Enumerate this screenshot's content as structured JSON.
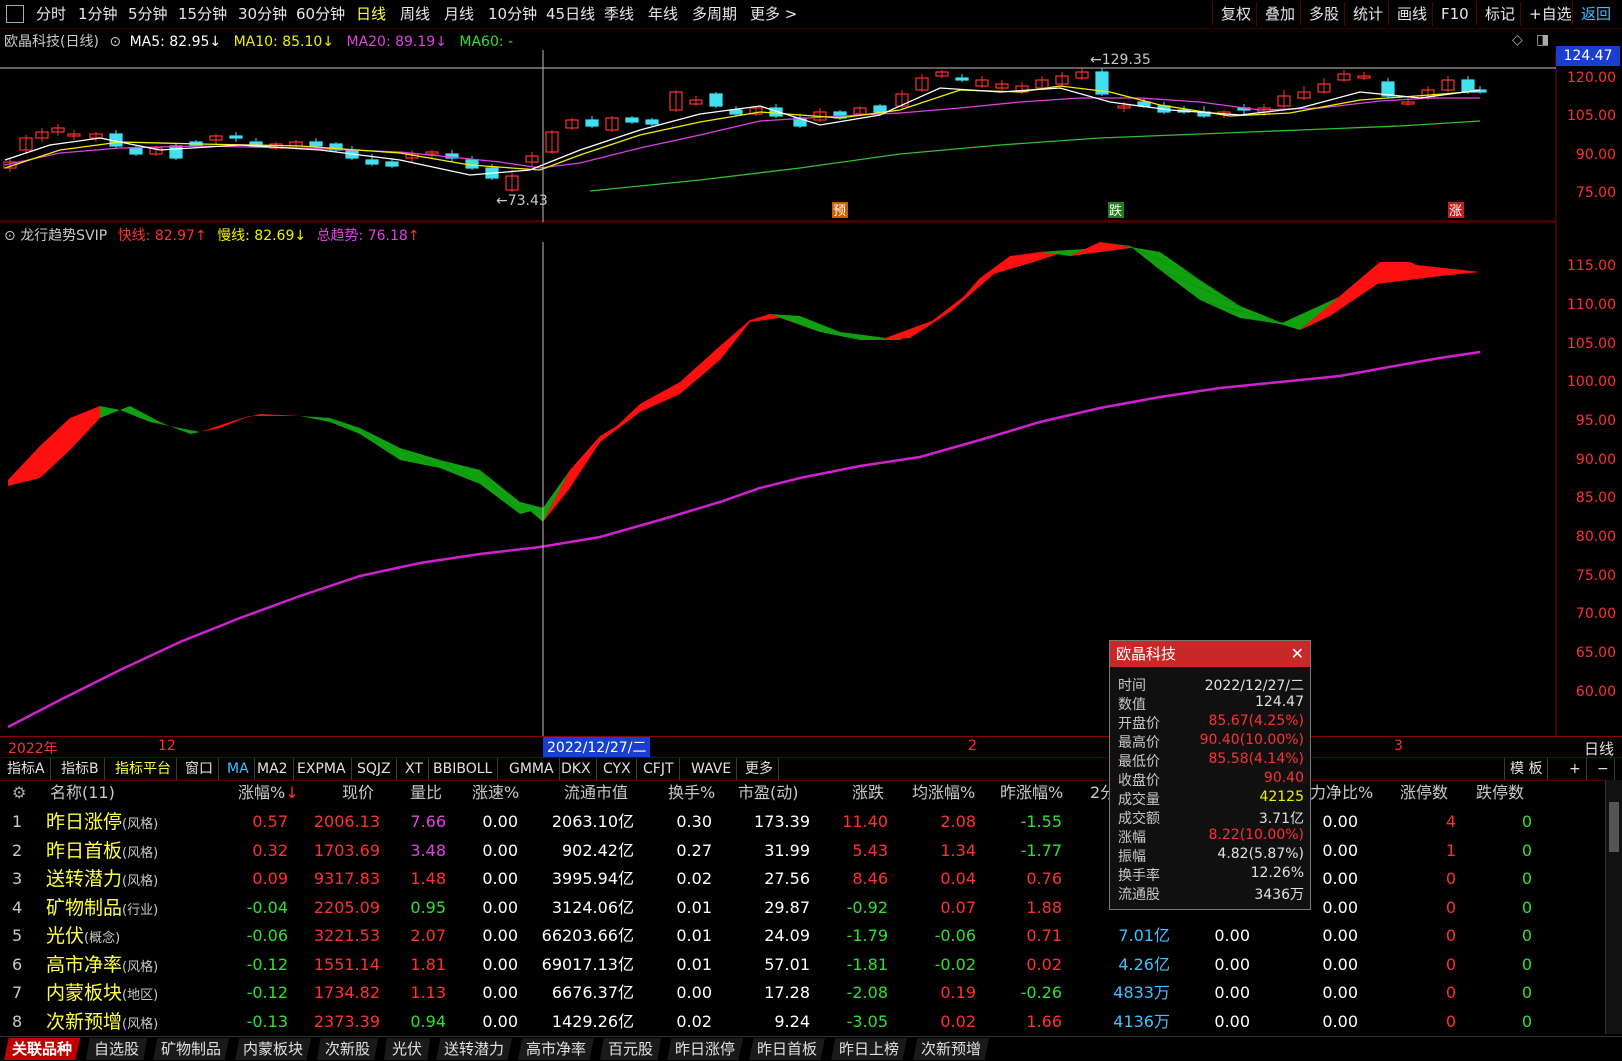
{
  "toolbar": {
    "periods": [
      "分时",
      "1分钟",
      "5分钟",
      "15分钟",
      "30分钟",
      "60分钟",
      "日线",
      "周线",
      "月线",
      "10分钟",
      "45日线",
      "季线",
      "年线",
      "多周期",
      "更多 >"
    ],
    "active_period": "日线",
    "right_buttons": [
      "复权",
      "叠加",
      "多股",
      "统计",
      "画线",
      "F10",
      "标记",
      "+自选",
      "返回"
    ]
  },
  "main_chart": {
    "title": "欧晶科技(日线)",
    "ma5": "MA5: 82.95",
    "ma10": "MA10: 85.10",
    "ma20": "MA20: 89.19",
    "ma60": "MA60: -",
    "high_mark": "129.35",
    "low_mark": "73.43",
    "current_price_tag": "124.47",
    "y_ticks": [
      "120.00",
      "105.00",
      "90.00",
      "75.00"
    ],
    "signals": [
      "预",
      "跌",
      "涨"
    ],
    "colors": {
      "ma5": "#ffffff",
      "ma10": "#f0f000",
      "ma20": "#e040e0",
      "ma60": "#30c030",
      "up": "#ff3030",
      "down": "#40e0f0"
    }
  },
  "indicator": {
    "name": "龙行趋势SVIP",
    "fast": "快线: 82.97",
    "slow": "慢线: 82.69",
    "trend": "总趋势: 76.18",
    "y_ticks": [
      "115.00",
      "110.00",
      "105.00",
      "100.00",
      "95.00",
      "90.00",
      "85.00",
      "80.00",
      "75.00",
      "70.00",
      "65.00",
      "60.00"
    ],
    "colors": {
      "rise_band": "#ff1010",
      "fall_band": "#10a010",
      "trend": "#d020d0"
    }
  },
  "x_axis": {
    "labels": [
      "2022年",
      "12",
      "2022/12/27/二",
      "2",
      "3"
    ],
    "right_label": "日线"
  },
  "indicator_tabs": [
    "指标A",
    "指标B",
    "指标平台",
    "窗口",
    "MA",
    "MA2",
    "EXPMA",
    "SQJZ",
    "XT",
    "BBIBOLL",
    "GMMA",
    "DKX",
    "CYX",
    "CFJT",
    "WAVE",
    "更多"
  ],
  "indicator_tabs_right": [
    "模 板",
    "+",
    "−"
  ],
  "table": {
    "headers": [
      "名称(11)",
      "涨幅%",
      "现价",
      "量比",
      "涨速%",
      "流通市值",
      "换手%",
      "市盈(动)",
      "涨跌",
      "均涨幅%",
      "昨涨幅%",
      "2分",
      "力净比%",
      "涨停数",
      "跌停数"
    ],
    "rows": [
      {
        "no": "1",
        "name": "昨日涨停",
        "tag": "(风格)",
        "chg": "0.57",
        "price": "2006.13",
        "vr": "7.66",
        "spd": "0.00",
        "mcap": "2063.10亿",
        "turn": "0.30",
        "pe": "173.39",
        "diff": "11.40",
        "avg": "2.08",
        "prev": "-1.55",
        "amt": "",
        "x1": "",
        "net": "0.00",
        "up": "4",
        "dn": "0"
      },
      {
        "no": "2",
        "name": "昨日首板",
        "tag": "(风格)",
        "chg": "0.32",
        "price": "1703.69",
        "vr": "3.48",
        "spd": "0.00",
        "mcap": "902.42亿",
        "turn": "0.27",
        "pe": "31.99",
        "diff": "5.43",
        "avg": "1.34",
        "prev": "-1.77",
        "amt": "",
        "x1": "",
        "net": "0.00",
        "up": "1",
        "dn": "0"
      },
      {
        "no": "3",
        "name": "送转潜力",
        "tag": "(风格)",
        "chg": "0.09",
        "price": "9317.83",
        "vr": "1.48",
        "spd": "0.00",
        "mcap": "3995.94亿",
        "turn": "0.02",
        "pe": "27.56",
        "diff": "8.46",
        "avg": "0.04",
        "prev": "0.76",
        "amt": "",
        "x1": "",
        "net": "0.00",
        "up": "0",
        "dn": "0"
      },
      {
        "no": "4",
        "name": "矿物制品",
        "tag": "(行业)",
        "chg": "-0.04",
        "price": "2205.09",
        "vr": "0.95",
        "spd": "0.00",
        "mcap": "3124.06亿",
        "turn": "0.01",
        "pe": "29.87",
        "diff": "-0.92",
        "avg": "0.07",
        "prev": "1.88",
        "amt": "",
        "x1": "",
        "net": "0.00",
        "up": "0",
        "dn": "0"
      },
      {
        "no": "5",
        "name": "光伏",
        "tag": "(概念)",
        "chg": "-0.06",
        "price": "3221.53",
        "vr": "2.07",
        "spd": "0.00",
        "mcap": "66203.66亿",
        "turn": "0.01",
        "pe": "24.09",
        "diff": "-1.79",
        "avg": "-0.06",
        "prev": "0.71",
        "amt": "7.01亿",
        "x1": "0.00",
        "net": "0.00",
        "up": "0",
        "dn": "0"
      },
      {
        "no": "6",
        "name": "高市净率",
        "tag": "(风格)",
        "chg": "-0.12",
        "price": "1551.14",
        "vr": "1.81",
        "spd": "0.00",
        "mcap": "69017.13亿",
        "turn": "0.01",
        "pe": "57.01",
        "diff": "-1.81",
        "avg": "-0.02",
        "prev": "0.02",
        "amt": "4.26亿",
        "x1": "0.00",
        "net": "0.00",
        "up": "0",
        "dn": "0"
      },
      {
        "no": "7",
        "name": "内蒙板块",
        "tag": "(地区)",
        "chg": "-0.12",
        "price": "1734.82",
        "vr": "1.13",
        "spd": "0.00",
        "mcap": "6676.37亿",
        "turn": "0.00",
        "pe": "17.28",
        "diff": "-2.08",
        "avg": "0.19",
        "prev": "-0.26",
        "amt": "4833万",
        "x1": "0.00",
        "net": "0.00",
        "up": "0",
        "dn": "0"
      },
      {
        "no": "8",
        "name": "次新预增",
        "tag": "(风格)",
        "chg": "-0.13",
        "price": "2373.39",
        "vr": "0.94",
        "spd": "0.00",
        "mcap": "1429.26亿",
        "turn": "0.02",
        "pe": "9.24",
        "diff": "-3.05",
        "avg": "0.02",
        "prev": "1.66",
        "amt": "4136万",
        "x1": "0.00",
        "net": "0.00",
        "up": "0",
        "dn": "0"
      }
    ]
  },
  "popup": {
    "title": "欧晶科技",
    "rows": [
      {
        "label": "时间",
        "value": "2022/12/27/二",
        "color": "#e0e0e0"
      },
      {
        "label": "数值",
        "value": "124.47",
        "color": "#e0e0e0"
      },
      {
        "label": "开盘价",
        "value": "85.67(4.25%)",
        "color": "#ff3030"
      },
      {
        "label": "最高价",
        "value": "90.40(10.00%)",
        "color": "#ff3030"
      },
      {
        "label": "最低价",
        "value": "85.58(4.14%)",
        "color": "#ff3030"
      },
      {
        "label": "收盘价",
        "value": "90.40",
        "color": "#ff3030"
      },
      {
        "label": "成交量",
        "value": "42125",
        "color": "#f0f000"
      },
      {
        "label": "成交额",
        "value": "3.71亿",
        "color": "#e0e0e0"
      },
      {
        "label": "涨幅",
        "value": "8.22(10.00%)",
        "color": "#ff3030"
      },
      {
        "label": "振幅",
        "value": "4.82(5.87%)",
        "color": "#e0e0e0"
      },
      {
        "label": "换手率",
        "value": "12.26%",
        "color": "#e0e0e0"
      },
      {
        "label": "流通股",
        "value": "3436万",
        "color": "#e0e0e0"
      }
    ]
  },
  "bottom_tabs": [
    "关联品种",
    "自选股",
    "矿物制品",
    "内蒙板块",
    "次新股",
    "光伏",
    "送转潜力",
    "高市净率",
    "百元股",
    "昨日涨停",
    "昨日首板",
    "昨日上榜",
    "次新预增"
  ],
  "active_bottom_tab": "关联品种"
}
